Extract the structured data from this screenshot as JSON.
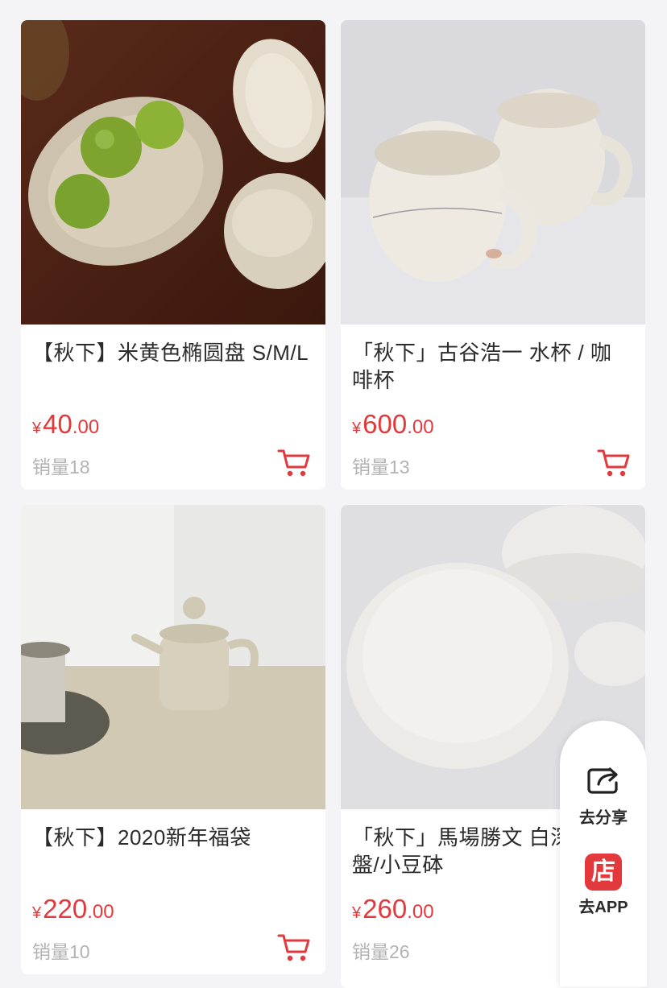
{
  "products": [
    {
      "title": "【秋下】米黄色椭圆盘 S/M/L",
      "currency": "¥",
      "price_int": "40",
      "price_dec": ".00",
      "sales": "销量18"
    },
    {
      "title": "「秋下」古谷浩一 水杯 / 咖啡杯",
      "currency": "¥",
      "price_int": "600",
      "price_dec": ".00",
      "sales": "销量13"
    },
    {
      "title": "【秋下】2020新年福袋",
      "currency": "¥",
      "price_int": "220",
      "price_dec": ".00",
      "sales": "销量10"
    },
    {
      "title": "「秋下」馬場勝文 白深砵/淺盤/小豆砵",
      "currency": "¥",
      "price_int": "260",
      "price_dec": ".00",
      "sales": "销量26"
    }
  ],
  "float_panel": {
    "share_label": "去分享",
    "app_badge": "店",
    "app_label": "去APP"
  },
  "colors": {
    "price": "#e4393c",
    "background": "#f4f4f6"
  },
  "icons": [
    "cart-icon",
    "share-icon",
    "store-icon"
  ]
}
